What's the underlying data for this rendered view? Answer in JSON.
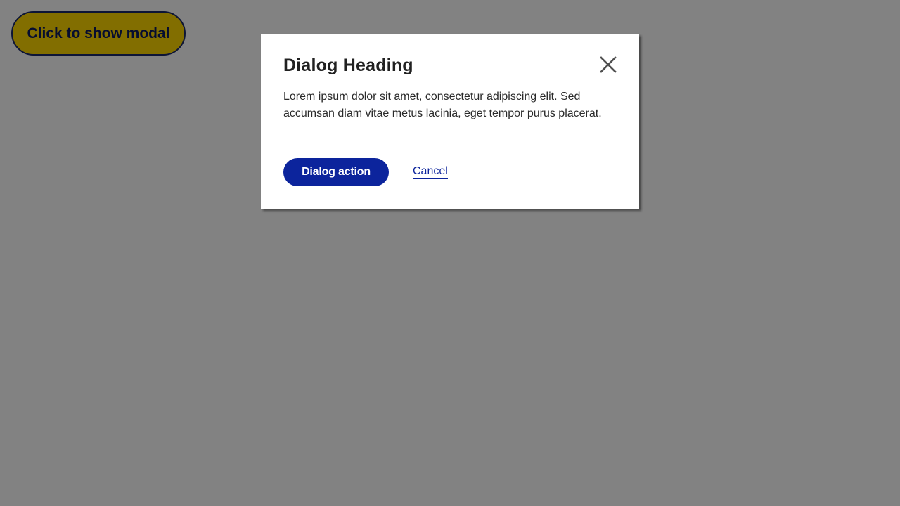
{
  "page": {
    "trigger_label": "Click to show modal"
  },
  "dialog": {
    "heading": "Dialog Heading",
    "body": "Lorem ipsum dolor sit amet, consectetur adipiscing elit. Sed accumsan diam vitae metus lacinia, eget tempor purus placerat.",
    "primary_action_label": "Dialog action",
    "cancel_label": "Cancel",
    "close_icon": "close-icon"
  },
  "colors": {
    "trigger_background": "#ffd700",
    "trigger_text": "#0d1b5e",
    "primary_button": "#0c249c",
    "overlay": "rgba(0,0,0,0.49)",
    "dialog_background": "#ffffff",
    "heading_text": "#212121"
  }
}
